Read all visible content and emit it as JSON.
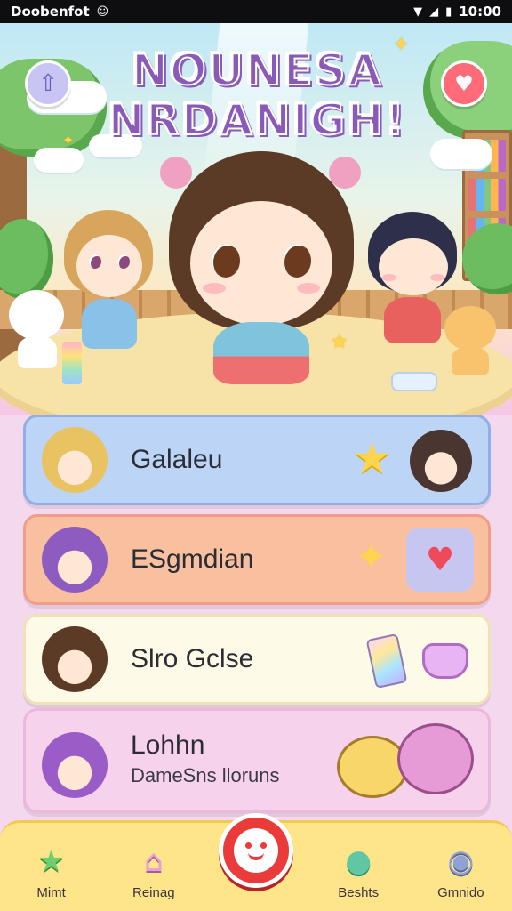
{
  "status_bar": {
    "left_text": "Doobenfot",
    "time": "10:00",
    "icons": [
      "notification-icon",
      "wifi-icon",
      "signal-icon",
      "battery-icon"
    ]
  },
  "hero": {
    "title_line1": "NOUNESA",
    "title_line2": "NRDANIGH!",
    "left_button_icon": "home-up-arrow-icon",
    "right_button_icon": "heart-balloon-icon"
  },
  "menu": [
    {
      "label": "Galaleu",
      "color": "#bcd4f5",
      "deco_icons": [
        "star-icon",
        "character-avatar"
      ]
    },
    {
      "label": "ESgmdian",
      "color": "#f8c09e",
      "deco_icons": [
        "sparkle-star-icon",
        "heart-icon"
      ]
    },
    {
      "label": "Slro Gclse",
      "color": "#fdfae8",
      "deco_icons": [
        "crystal-icon",
        "gem-icon"
      ]
    },
    {
      "label": "Lohhn",
      "sublabel": "DameSns lloruns",
      "color": "#f7d2ec",
      "deco_icons": [
        "cat-duo-illustration"
      ]
    }
  ],
  "bottom_nav": {
    "items": [
      {
        "label": "Mimt",
        "icon": "star-icon"
      },
      {
        "label": "Reinag",
        "icon": "house-icon"
      },
      {
        "label": "",
        "icon": "center-face-icon"
      },
      {
        "label": "Beshts",
        "icon": "monster-icon"
      },
      {
        "label": "Gmnido",
        "icon": "profile-icon"
      }
    ]
  },
  "colors": {
    "nav_bg": "#ffe58a",
    "center_button": "#ea3b3b",
    "status_bar": "#0e0e10"
  }
}
